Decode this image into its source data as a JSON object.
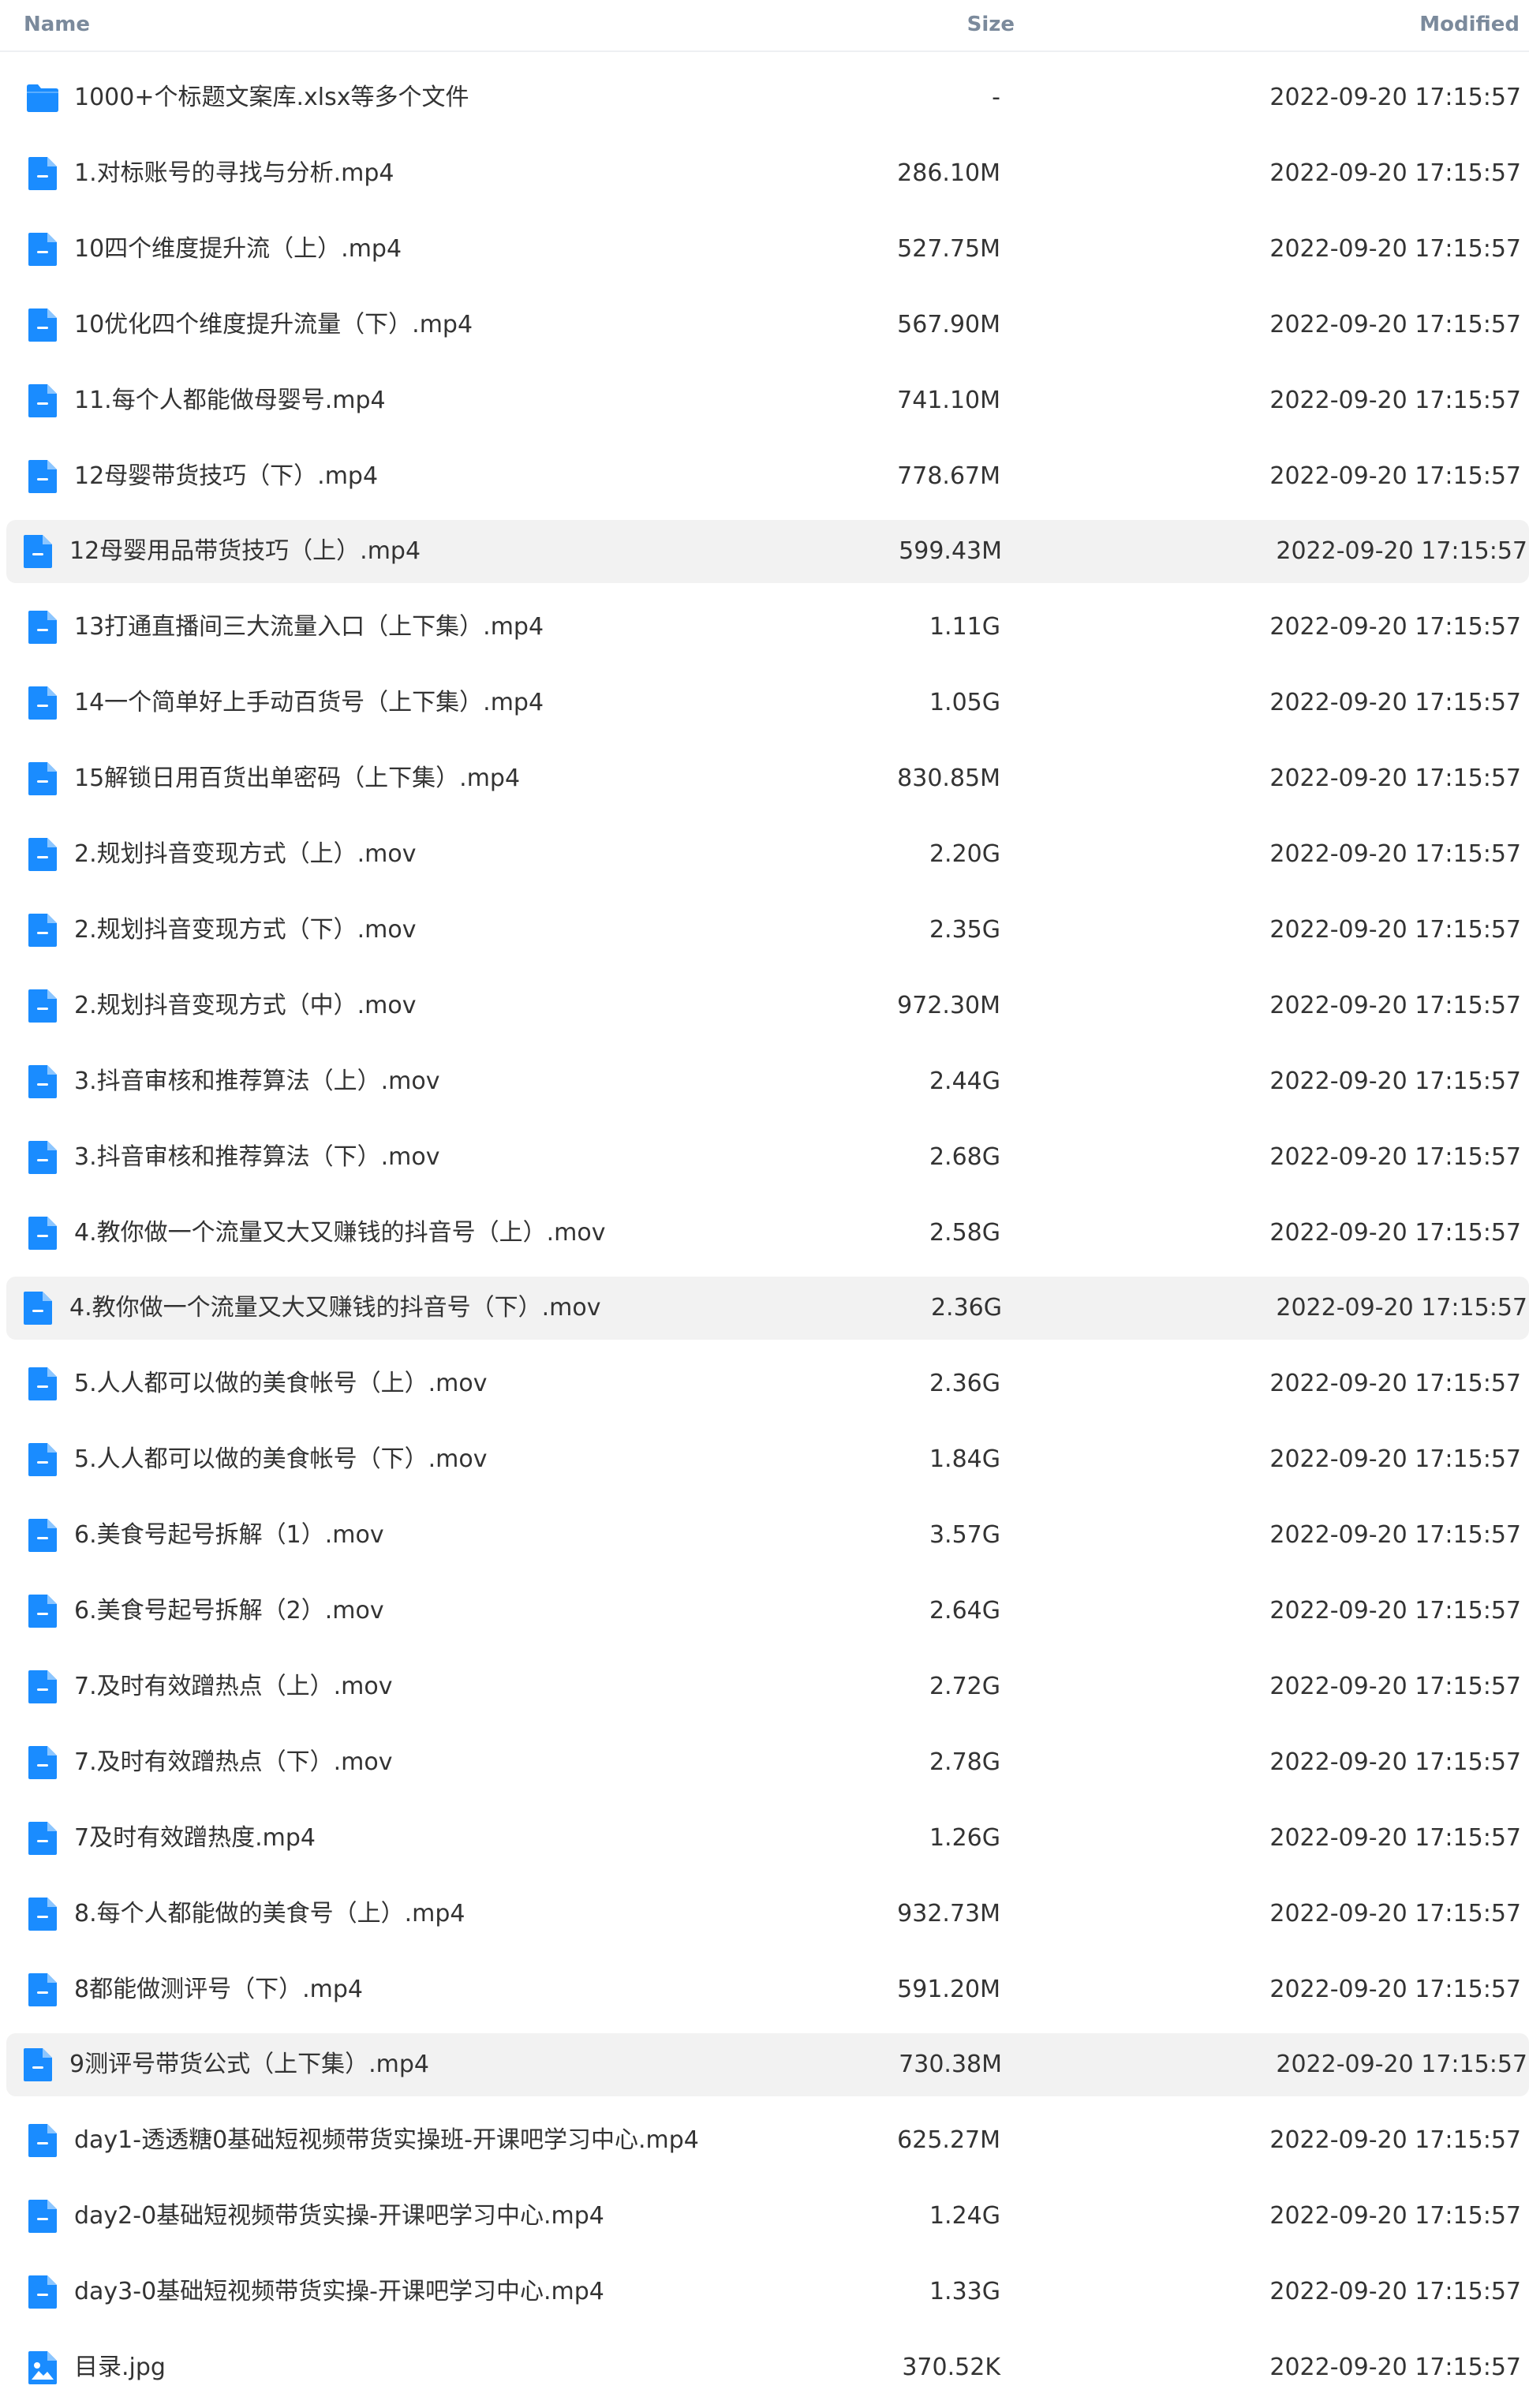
{
  "columns": {
    "name": "Name",
    "size": "Size",
    "modified": "Modified"
  },
  "colors": {
    "accent": "#1a8cff",
    "highlight_row": "#f2f2f2",
    "header_text": "#7b8a9c"
  },
  "rows": [
    {
      "name": "1000+个标题文案库.xlsx等多个文件",
      "size": "-",
      "modified": "2022-09-20 17:15:57",
      "icon": "folder-icon",
      "highlighted": false
    },
    {
      "name": "1.对标账号的寻找与分析.mp4",
      "size": "286.10M",
      "modified": "2022-09-20 17:15:57",
      "icon": "file-icon",
      "highlighted": false
    },
    {
      "name": "10四个维度提升流（上）.mp4",
      "size": "527.75M",
      "modified": "2022-09-20 17:15:57",
      "icon": "file-icon",
      "highlighted": false
    },
    {
      "name": "10优化四个维度提升流量（下）.mp4",
      "size": "567.90M",
      "modified": "2022-09-20 17:15:57",
      "icon": "file-icon",
      "highlighted": false
    },
    {
      "name": "11.每个人都能做母婴号.mp4",
      "size": "741.10M",
      "modified": "2022-09-20 17:15:57",
      "icon": "file-icon",
      "highlighted": false
    },
    {
      "name": "12母婴带货技巧（下）.mp4",
      "size": "778.67M",
      "modified": "2022-09-20 17:15:57",
      "icon": "file-icon",
      "highlighted": false
    },
    {
      "name": "12母婴用品带货技巧（上）.mp4",
      "size": "599.43M",
      "modified": "2022-09-20 17:15:57",
      "icon": "file-icon",
      "highlighted": true
    },
    {
      "name": "13打通直播间三大流量入口（上下集）.mp4",
      "size": "1.11G",
      "modified": "2022-09-20 17:15:57",
      "icon": "file-icon",
      "highlighted": false
    },
    {
      "name": "14一个简单好上手动百货号（上下集）.mp4",
      "size": "1.05G",
      "modified": "2022-09-20 17:15:57",
      "icon": "file-icon",
      "highlighted": false
    },
    {
      "name": "15解锁日用百货出单密码（上下集）.mp4",
      "size": "830.85M",
      "modified": "2022-09-20 17:15:57",
      "icon": "file-icon",
      "highlighted": false
    },
    {
      "name": "2.规划抖音变现方式（上）.mov",
      "size": "2.20G",
      "modified": "2022-09-20 17:15:57",
      "icon": "file-icon",
      "highlighted": false
    },
    {
      "name": "2.规划抖音变现方式（下）.mov",
      "size": "2.35G",
      "modified": "2022-09-20 17:15:57",
      "icon": "file-icon",
      "highlighted": false
    },
    {
      "name": "2.规划抖音变现方式（中）.mov",
      "size": "972.30M",
      "modified": "2022-09-20 17:15:57",
      "icon": "file-icon",
      "highlighted": false
    },
    {
      "name": "3.抖音审核和推荐算法（上）.mov",
      "size": "2.44G",
      "modified": "2022-09-20 17:15:57",
      "icon": "file-icon",
      "highlighted": false
    },
    {
      "name": "3.抖音审核和推荐算法（下）.mov",
      "size": "2.68G",
      "modified": "2022-09-20 17:15:57",
      "icon": "file-icon",
      "highlighted": false
    },
    {
      "name": "4.教你做一个流量又大又赚钱的抖音号（上）.mov",
      "size": "2.58G",
      "modified": "2022-09-20 17:15:57",
      "icon": "file-icon",
      "highlighted": false
    },
    {
      "name": "4.教你做一个流量又大又赚钱的抖音号（下）.mov",
      "size": "2.36G",
      "modified": "2022-09-20 17:15:57",
      "icon": "file-icon",
      "highlighted": true
    },
    {
      "name": "5.人人都可以做的美食帐号（上）.mov",
      "size": "2.36G",
      "modified": "2022-09-20 17:15:57",
      "icon": "file-icon",
      "highlighted": false
    },
    {
      "name": "5.人人都可以做的美食帐号（下）.mov",
      "size": "1.84G",
      "modified": "2022-09-20 17:15:57",
      "icon": "file-icon",
      "highlighted": false
    },
    {
      "name": "6.美食号起号拆解（1）.mov",
      "size": "3.57G",
      "modified": "2022-09-20 17:15:57",
      "icon": "file-icon",
      "highlighted": false
    },
    {
      "name": "6.美食号起号拆解（2）.mov",
      "size": "2.64G",
      "modified": "2022-09-20 17:15:57",
      "icon": "file-icon",
      "highlighted": false
    },
    {
      "name": "7.及时有效蹭热点（上）.mov",
      "size": "2.72G",
      "modified": "2022-09-20 17:15:57",
      "icon": "file-icon",
      "highlighted": false
    },
    {
      "name": "7.及时有效蹭热点（下）.mov",
      "size": "2.78G",
      "modified": "2022-09-20 17:15:57",
      "icon": "file-icon",
      "highlighted": false
    },
    {
      "name": "7及时有效蹭热度.mp4",
      "size": "1.26G",
      "modified": "2022-09-20 17:15:57",
      "icon": "file-icon",
      "highlighted": false
    },
    {
      "name": "8.每个人都能做的美食号（上）.mp4",
      "size": "932.73M",
      "modified": "2022-09-20 17:15:57",
      "icon": "file-icon",
      "highlighted": false
    },
    {
      "name": "8都能做测评号（下）.mp4",
      "size": "591.20M",
      "modified": "2022-09-20 17:15:57",
      "icon": "file-icon",
      "highlighted": false
    },
    {
      "name": "9测评号带货公式（上下集）.mp4",
      "size": "730.38M",
      "modified": "2022-09-20 17:15:57",
      "icon": "file-icon",
      "highlighted": true
    },
    {
      "name": "day1-透透糖0基础短视频带货实操班-开课吧学习中心.mp4",
      "size": "625.27M",
      "modified": "2022-09-20 17:15:57",
      "icon": "file-icon",
      "highlighted": false
    },
    {
      "name": "day2-0基础短视频带货实操-开课吧学习中心.mp4",
      "size": "1.24G",
      "modified": "2022-09-20 17:15:57",
      "icon": "file-icon",
      "highlighted": false
    },
    {
      "name": "day3-0基础短视频带货实操-开课吧学习中心.mp4",
      "size": "1.33G",
      "modified": "2022-09-20 17:15:57",
      "icon": "file-icon",
      "highlighted": false
    },
    {
      "name": "目录.jpg",
      "size": "370.52K",
      "modified": "2022-09-20 17:15:57",
      "icon": "image-file-icon",
      "highlighted": false
    }
  ]
}
